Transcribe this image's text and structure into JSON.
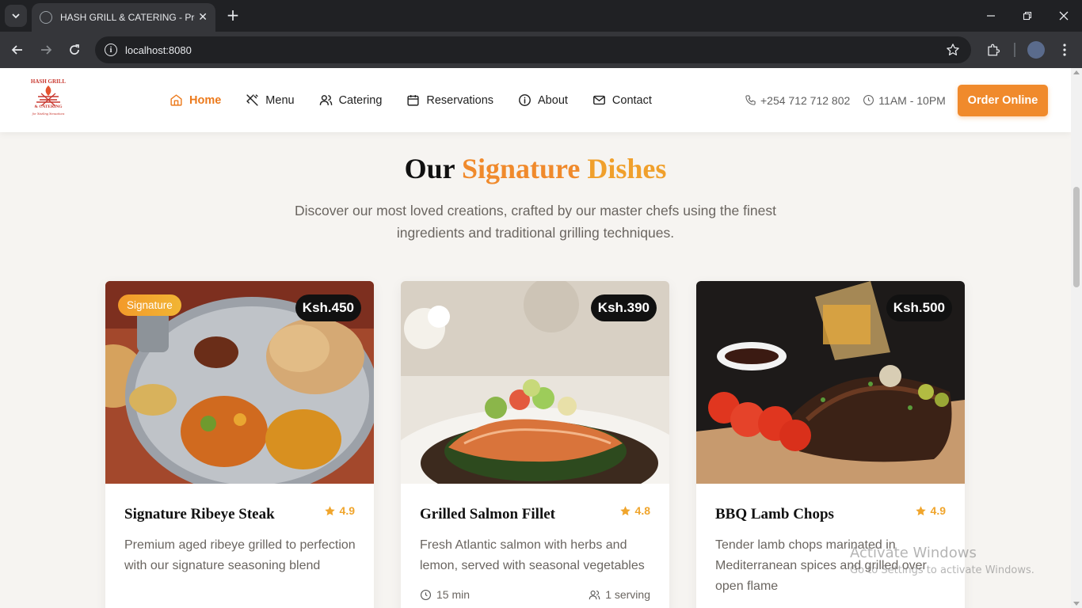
{
  "browser": {
    "tab_title": "HASH GRILL & CATERING - Pre",
    "url": "localhost:8080"
  },
  "header": {
    "logo_text": [
      "HASH GRILL",
      "& CATERING",
      "for Sizzling Sensations"
    ],
    "nav": [
      {
        "label": "Home",
        "icon": "home-icon",
        "active": true
      },
      {
        "label": "Menu",
        "icon": "utensils-icon",
        "active": false
      },
      {
        "label": "Catering",
        "icon": "users-icon",
        "active": false
      },
      {
        "label": "Reservations",
        "icon": "calendar-icon",
        "active": false
      },
      {
        "label": "About",
        "icon": "info-icon",
        "active": false
      },
      {
        "label": "Contact",
        "icon": "mail-icon",
        "active": false
      }
    ],
    "phone": "+254 712 712 802",
    "hours": "11AM - 10PM",
    "order_button": "Order Online"
  },
  "section": {
    "title_part1": "Our",
    "title_part2": "Signature",
    "title_part3": "Dishes",
    "subtitle": "Discover our most loved creations, crafted by our master chefs using the finest ingredients and traditional grilling techniques."
  },
  "dishes": [
    {
      "name": "Signature Ribeye Steak",
      "price": "Ksh.450",
      "rating": "4.9",
      "tag": "Signature",
      "description": "Premium aged ribeye grilled to perfection with our signature seasoning blend"
    },
    {
      "name": "Grilled Salmon Fillet",
      "price": "Ksh.390",
      "rating": "4.8",
      "description": "Fresh Atlantic salmon with herbs and lemon, served with seasonal vegetables",
      "time": "15 min",
      "serving": "1 serving"
    },
    {
      "name": "BBQ Lamb Chops",
      "price": "Ksh.500",
      "rating": "4.9",
      "description": "Tender lamb chops marinated in Mediterranean spices and grilled over open flame"
    }
  ],
  "watermark": {
    "line1": "Activate Windows",
    "line2": "Go to Settings to activate Windows."
  },
  "colors": {
    "accent": "#f08a2c",
    "page_bg": "#f6f4f1"
  }
}
